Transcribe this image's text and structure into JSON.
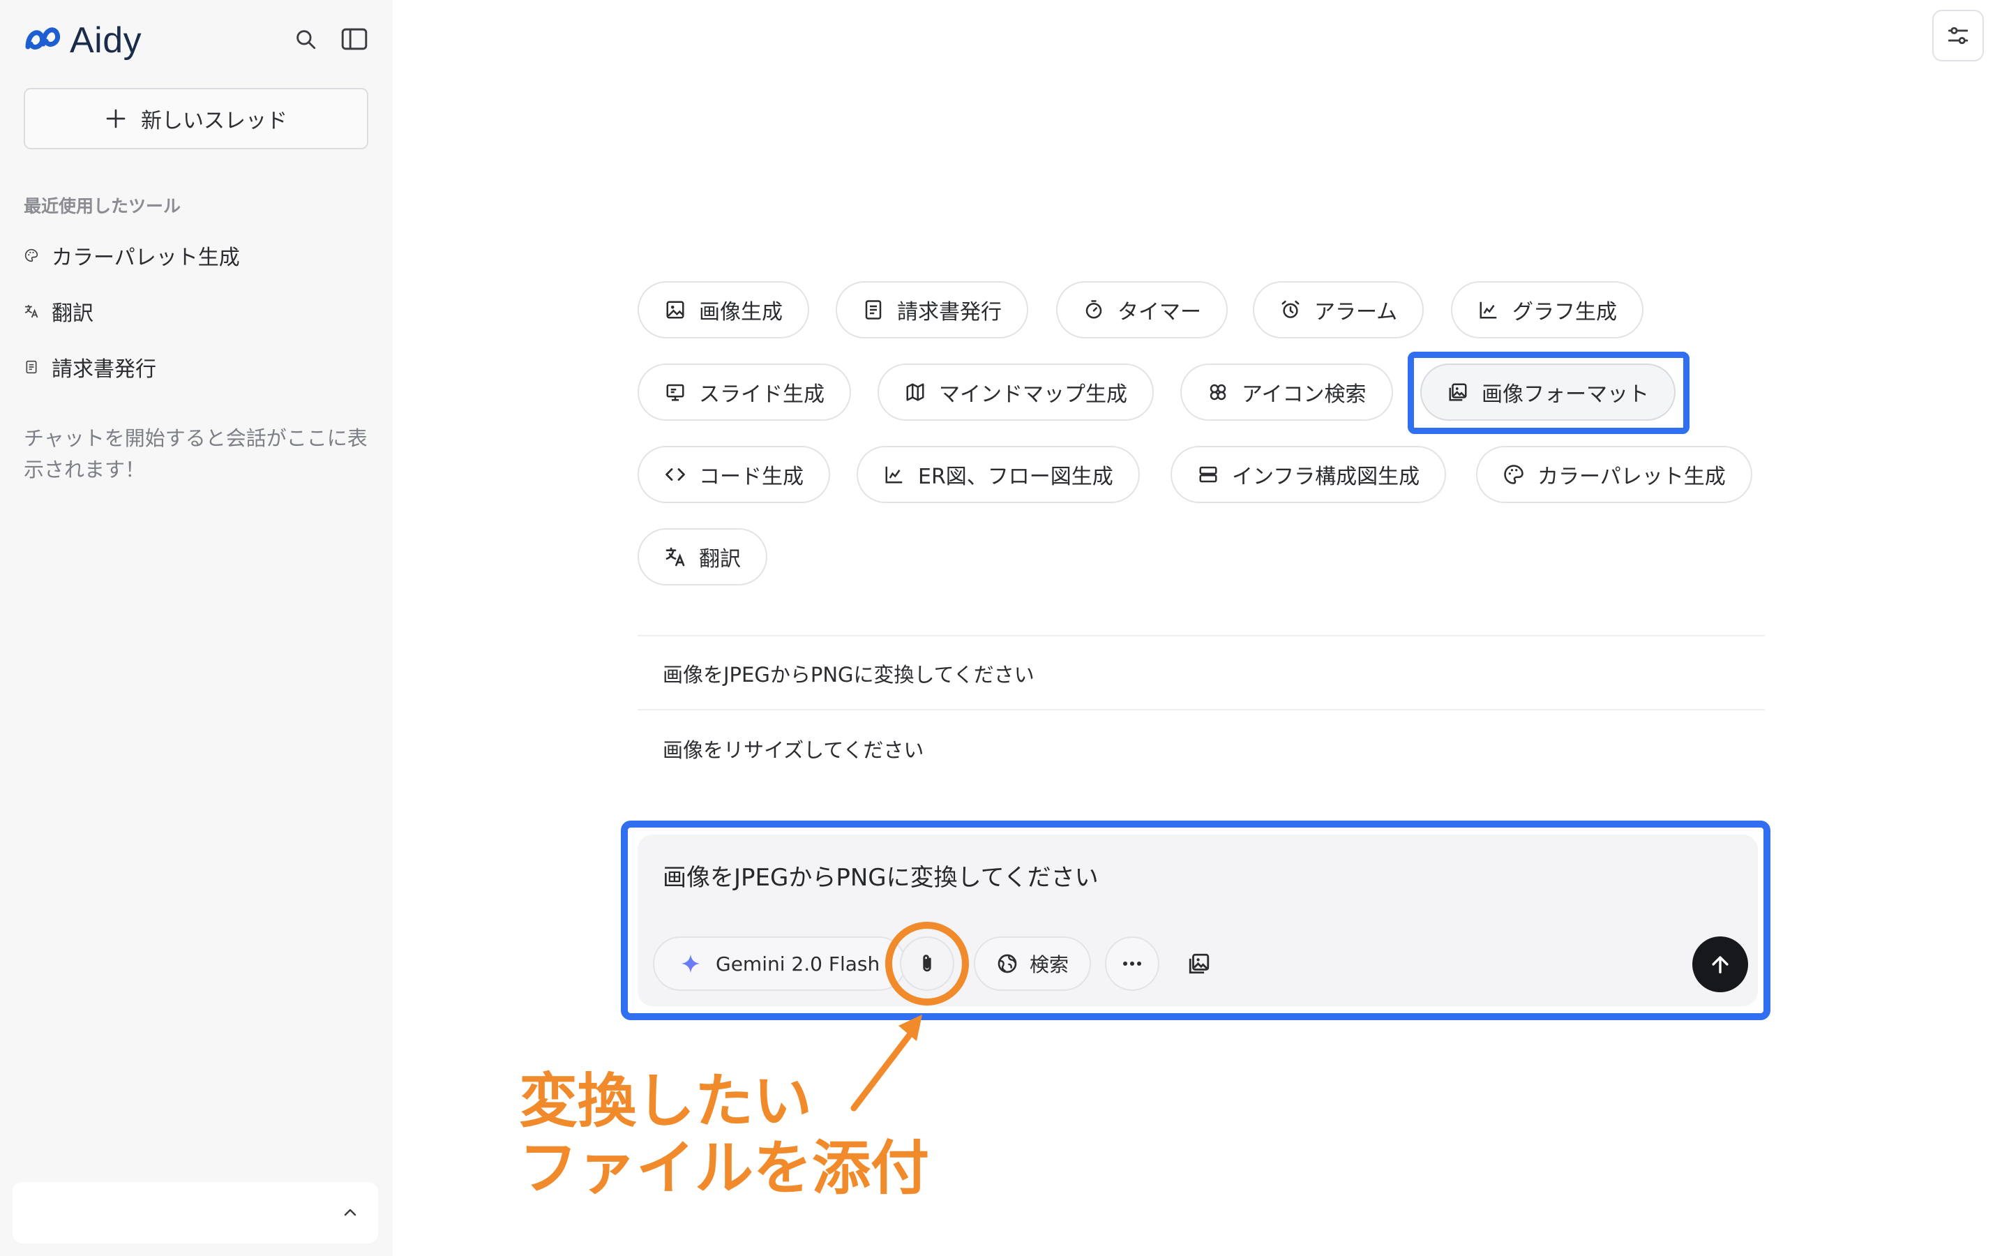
{
  "app": {
    "name": "Aidy"
  },
  "sidebar": {
    "new_thread_label": "新しいスレッド",
    "recent_label": "最近使用したツール",
    "recent_items": [
      {
        "label": "カラーパレット生成",
        "icon": "palette-icon"
      },
      {
        "label": "翻訳",
        "icon": "translate-icon"
      },
      {
        "label": "請求書発行",
        "icon": "invoice-icon"
      }
    ],
    "empty_message": "チャットを開始すると会話がここに表示されます！"
  },
  "tools": [
    {
      "label": "画像生成",
      "icon": "image-icon"
    },
    {
      "label": "請求書発行",
      "icon": "invoice-icon"
    },
    {
      "label": "タイマー",
      "icon": "timer-icon"
    },
    {
      "label": "アラーム",
      "icon": "alarm-icon"
    },
    {
      "label": "グラフ生成",
      "icon": "chart-icon"
    },
    {
      "label": "スライド生成",
      "icon": "slides-icon"
    },
    {
      "label": "マインドマップ生成",
      "icon": "map-icon"
    },
    {
      "label": "アイコン検索",
      "icon": "icons-icon"
    },
    {
      "label": "画像フォーマット",
      "icon": "image-format-icon",
      "selected": true
    },
    {
      "label": "コード生成",
      "icon": "code-icon"
    },
    {
      "label": "ER図、フロー図生成",
      "icon": "chart-icon"
    },
    {
      "label": "インフラ構成図生成",
      "icon": "server-icon"
    },
    {
      "label": "カラーパレット生成",
      "icon": "palette-icon"
    },
    {
      "label": "翻訳",
      "icon": "translate-icon"
    }
  ],
  "suggestions": [
    "画像をJPEGからPNGに変換してください",
    "画像をリサイズしてください"
  ],
  "composer": {
    "text": "画像をJPEGからPNGに変換してください",
    "model": "Gemini 2.0 Flash",
    "search_label": "検索"
  },
  "annotation": {
    "line1": "変換したい",
    "line2": "ファイルを添付",
    "color": "#f08a2a"
  },
  "colors": {
    "highlight": "#2f6ff0",
    "annotation": "#f08a2a"
  }
}
